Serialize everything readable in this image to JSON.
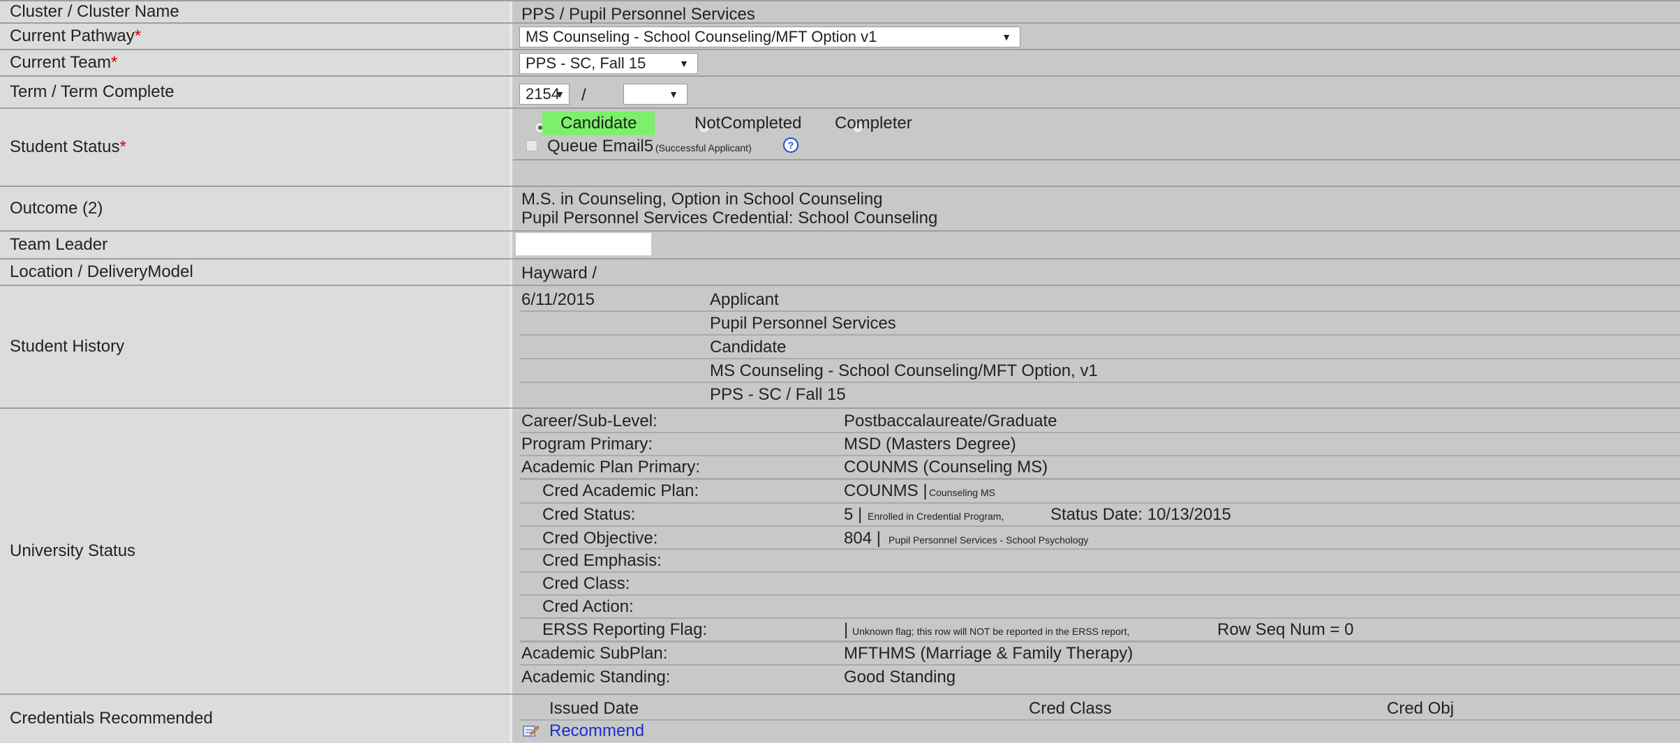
{
  "rows": {
    "cluster": {
      "label": "Cluster / Cluster Name",
      "value": "PPS / Pupil Personnel Services"
    },
    "pathway": {
      "label": "Current Pathway",
      "required": "*",
      "value": "MS Counseling - School Counseling/MFT Option v1"
    },
    "team": {
      "label": "Current Team",
      "required": "*",
      "value": "PPS - SC, Fall 15"
    },
    "term": {
      "label": "Term / Term Complete",
      "term_value": "2154",
      "separator": "/",
      "complete_value": ""
    },
    "status": {
      "label": "Student Status",
      "required": "*",
      "options": [
        "Candidate",
        "NotCompleted",
        "Completer"
      ],
      "selected": "Candidate",
      "queue_label": "Queue Email5",
      "queue_note": "(Successful Applicant)",
      "help_icon": "?"
    },
    "outcome": {
      "label": "Outcome (2)",
      "lines": [
        "M.S. in Counseling, Option in School Counseling",
        "Pupil Personnel Services Credential: School Counseling"
      ]
    },
    "team_leader": {
      "label": "Team Leader",
      "value": ""
    },
    "location": {
      "label": "Location / DeliveryModel",
      "value": "Hayward /"
    },
    "history": {
      "label": "Student History",
      "date": "6/11/2015",
      "entries": [
        "Applicant",
        "Pupil Personnel Services",
        "Candidate",
        "MS Counseling - School Counseling/MFT Option, v1",
        "PPS - SC / Fall 15"
      ]
    },
    "university": {
      "label": "University Status",
      "career_label": "Career/Sub-Level:",
      "career_value": "Postbaccalaureate/Graduate",
      "program_label": "Program Primary:",
      "program_value": "MSD (Masters Degree)",
      "plan_label": "Academic Plan Primary:",
      "plan_value": "COUNMS (Counseling MS)",
      "cred_plan_label": "Cred Academic Plan:",
      "cred_plan_code": "COUNMS |",
      "cred_plan_note": "Counseling MS",
      "cred_status_label": "Cred Status:",
      "cred_status_code": "5 |",
      "cred_status_note": "Enrolled in Credential Program,",
      "cred_status_date": "Status Date: 10/13/2015",
      "cred_obj_label": "Cred Objective:",
      "cred_obj_code": "804 |",
      "cred_obj_note": "Pupil Personnel Services - School Psychology",
      "cred_emph_label": "Cred Emphasis:",
      "cred_class_label": "Cred Class:",
      "cred_action_label": "Cred Action:",
      "erss_label": "ERSS Reporting Flag:",
      "erss_code": "|",
      "erss_note": "Unknown flag; this row will NOT be reported in the ERSS report,",
      "erss_seq": "Row Seq Num = 0",
      "subplan_label": "Academic SubPlan:",
      "subplan_value": "MFTHMS (Marriage & Family Therapy)",
      "standing_label": "Academic Standing:",
      "standing_value": "Good Standing"
    },
    "credentials": {
      "label": "Credentials Recommended",
      "col_issued": "Issued Date",
      "col_class": "Cred Class",
      "col_obj": "Cred Obj",
      "recommend_link": "Recommend"
    }
  },
  "colors": {
    "candidate_highlight": "#7cf06a",
    "required": "#d00000",
    "link": "#1a2fd0"
  }
}
